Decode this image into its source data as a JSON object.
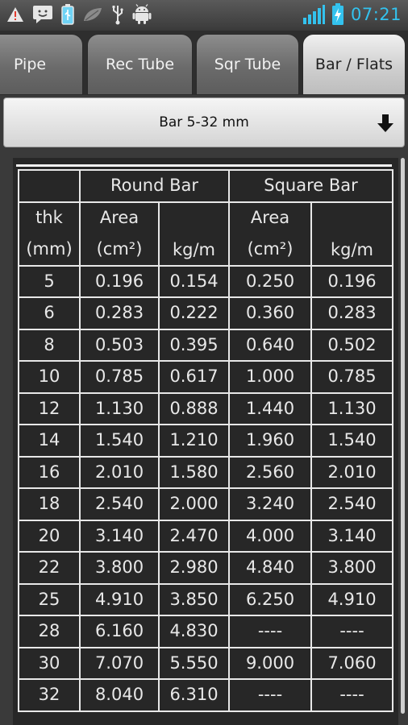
{
  "status_bar": {
    "time": "07:21",
    "left_icons": [
      "warning-icon",
      "message-icon",
      "battery-usb-icon",
      "leaf-icon",
      "usb-icon",
      "android-icon"
    ],
    "right_icons": [
      "signal-icon",
      "battery-charging-icon"
    ],
    "accent_color": "#33c2ee",
    "warning_color": "#e23b2e"
  },
  "tabs": [
    {
      "label": "Pipe",
      "active": false
    },
    {
      "label": "Rec Tube",
      "active": false
    },
    {
      "label": "Sqr Tube",
      "active": false
    },
    {
      "label": "Bar / Flats",
      "active": true
    }
  ],
  "dropdown": {
    "selected": "Bar 5-32 mm",
    "icon": "arrow-down-icon"
  },
  "table": {
    "group_headers": [
      "Round Bar",
      "Square Bar"
    ],
    "col_headers": {
      "thk": [
        "thk",
        "(mm)"
      ],
      "round_area": [
        "Area",
        "(cm²)"
      ],
      "round_kgm": "kg/m",
      "square_area": [
        "Area",
        "(cm²)"
      ],
      "square_kgm": "kg/m"
    },
    "rows": [
      [
        "5",
        "0.196",
        "0.154",
        "0.250",
        "0.196"
      ],
      [
        "6",
        "0.283",
        "0.222",
        "0.360",
        "0.283"
      ],
      [
        "8",
        "0.503",
        "0.395",
        "0.640",
        "0.502"
      ],
      [
        "10",
        "0.785",
        "0.617",
        "1.000",
        "0.785"
      ],
      [
        "12",
        "1.130",
        "0.888",
        "1.440",
        "1.130"
      ],
      [
        "14",
        "1.540",
        "1.210",
        "1.960",
        "1.540"
      ],
      [
        "16",
        "2.010",
        "1.580",
        "2.560",
        "2.010"
      ],
      [
        "18",
        "2.540",
        "2.000",
        "3.240",
        "2.540"
      ],
      [
        "20",
        "3.140",
        "2.470",
        "4.000",
        "3.140"
      ],
      [
        "22",
        "3.800",
        "2.980",
        "4.840",
        "3.800"
      ],
      [
        "25",
        "4.910",
        "3.850",
        "6.250",
        "4.910"
      ],
      [
        "28",
        "6.160",
        "4.830",
        "----",
        "----"
      ],
      [
        "30",
        "7.070",
        "5.550",
        "9.000",
        "7.060"
      ],
      [
        "32",
        "8.040",
        "6.310",
        "----",
        "----"
      ]
    ]
  }
}
